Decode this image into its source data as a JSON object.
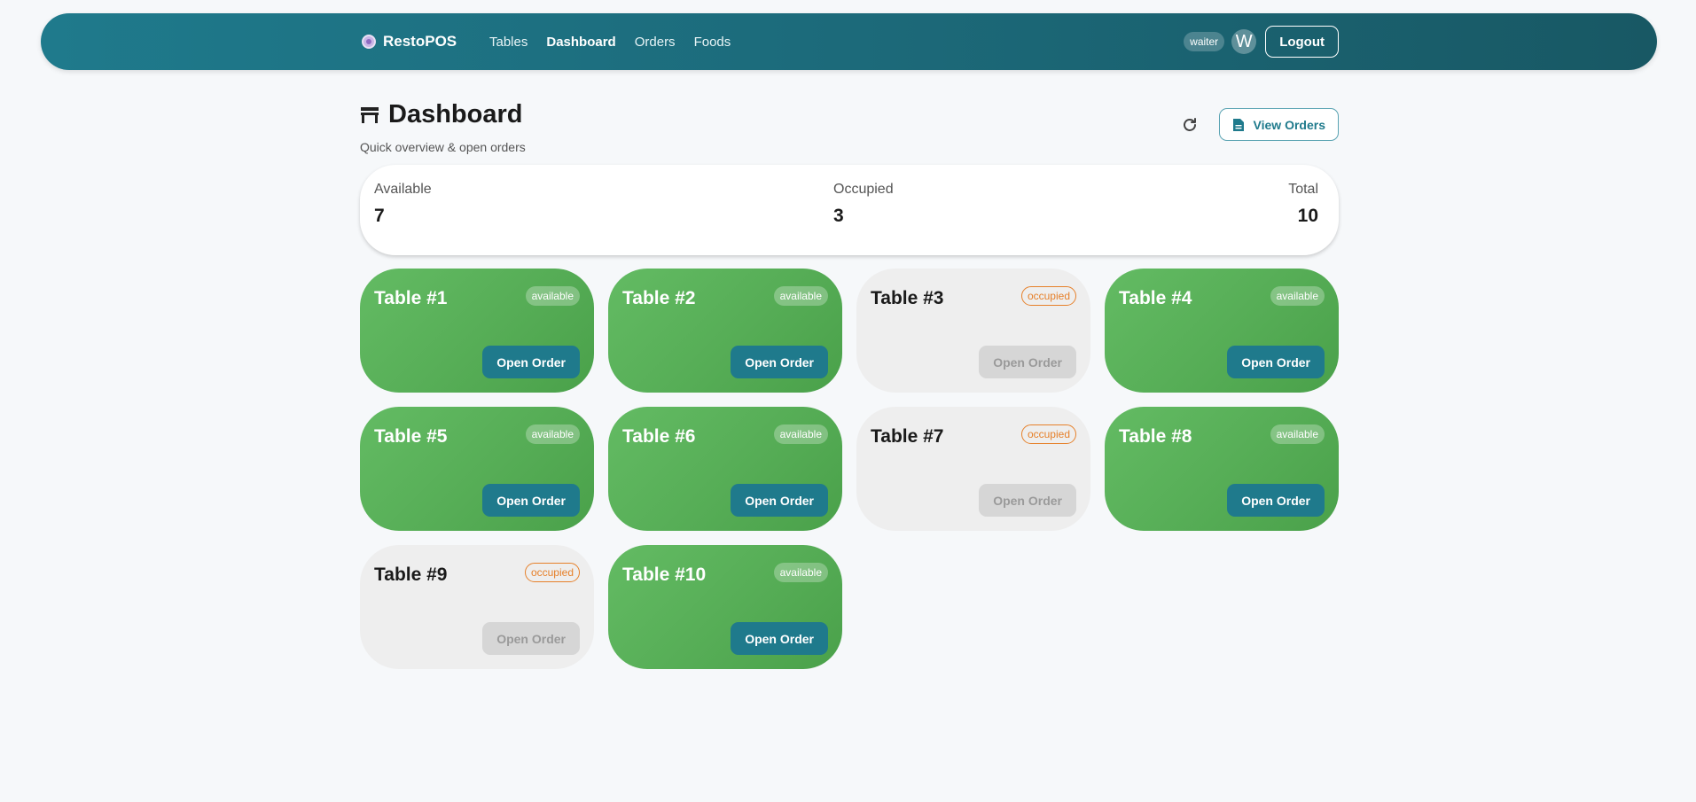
{
  "nav": {
    "brand": "RestoPOS",
    "links": [
      {
        "label": "Tables",
        "active": false
      },
      {
        "label": "Dashboard",
        "active": true
      },
      {
        "label": "Orders",
        "active": false
      },
      {
        "label": "Foods",
        "active": false
      }
    ],
    "role": "waiter",
    "avatar_initial": "W",
    "logout_label": "Logout"
  },
  "header": {
    "title": "Dashboard",
    "subtitle": "Quick overview & open orders",
    "view_orders_label": "View Orders",
    "icons": {
      "title": "table-icon",
      "refresh": "refresh-icon",
      "view_orders": "document-icon"
    }
  },
  "stats": {
    "available_label": "Available",
    "available": "7",
    "occupied_label": "Occupied",
    "occupied": "3",
    "total_label": "Total",
    "total": "10"
  },
  "tables": [
    {
      "name": "Table #1",
      "status": "available",
      "action": "Open Order"
    },
    {
      "name": "Table #2",
      "status": "available",
      "action": "Open Order"
    },
    {
      "name": "Table #3",
      "status": "occupied",
      "action": "Open Order"
    },
    {
      "name": "Table #4",
      "status": "available",
      "action": "Open Order"
    },
    {
      "name": "Table #5",
      "status": "available",
      "action": "Open Order"
    },
    {
      "name": "Table #6",
      "status": "available",
      "action": "Open Order"
    },
    {
      "name": "Table #7",
      "status": "occupied",
      "action": "Open Order"
    },
    {
      "name": "Table #8",
      "status": "available",
      "action": "Open Order"
    },
    {
      "name": "Table #9",
      "status": "occupied",
      "action": "Open Order"
    },
    {
      "name": "Table #10",
      "status": "available",
      "action": "Open Order"
    }
  ],
  "colors": {
    "primary": "#1f7a8c",
    "available": "#5cb35c",
    "occupied_bg": "#eeeeee",
    "occupied_accent": "#e6802a"
  }
}
